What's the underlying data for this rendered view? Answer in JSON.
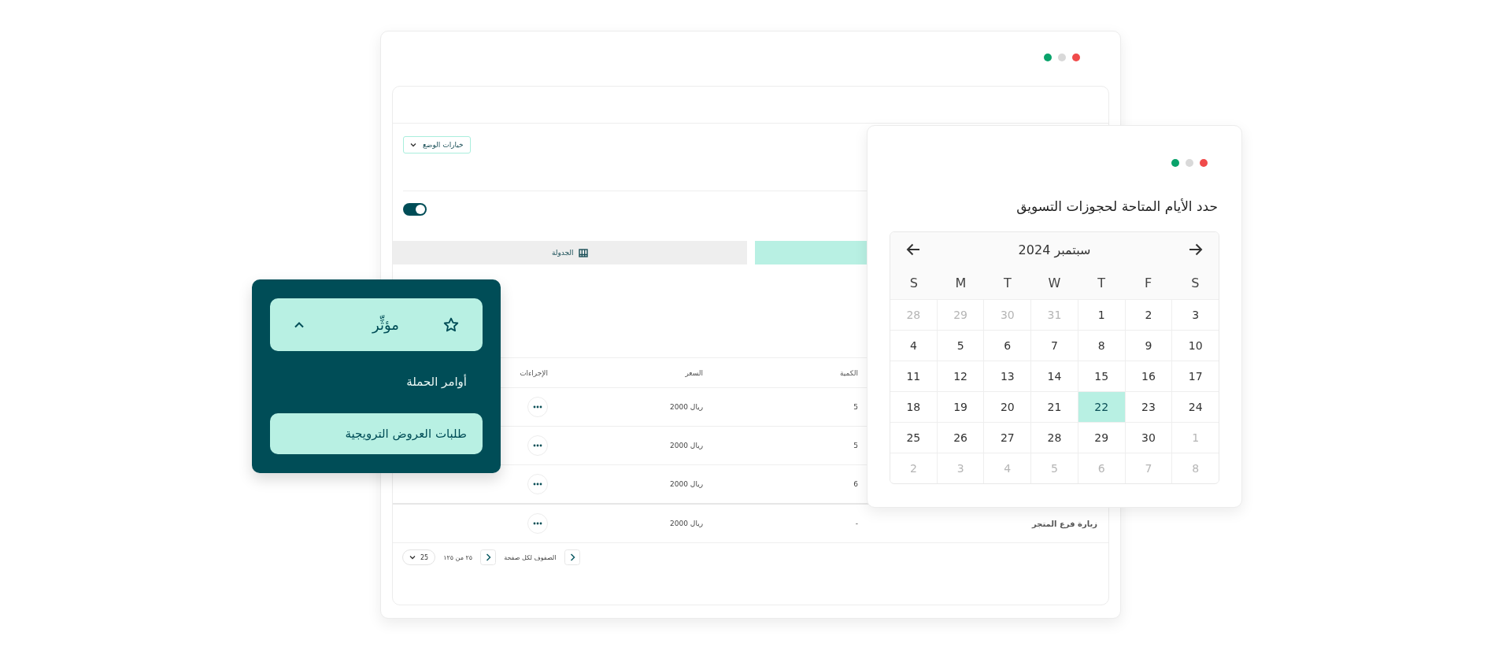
{
  "main_window": {
    "controls": [
      {
        "color": "#0aa36b"
      },
      {
        "color": "#d9d9d9"
      },
      {
        "color": "#f04b4b"
      }
    ],
    "mode_dropdown": {
      "label": "خيارات الوضع"
    },
    "toggle": {
      "on": true
    },
    "tabs": [
      {
        "label": "الجدولة",
        "selected": false
      },
      {
        "selected": true
      }
    ],
    "table": {
      "columns": [
        "الكمية",
        "السعر",
        "الإجراءات"
      ],
      "rows": [
        {
          "quantity": "5",
          "price": "ريال 2000"
        },
        {
          "quantity": "5",
          "price": "ريال 2000"
        },
        {
          "quantity": "6",
          "price": "ريال 2000"
        },
        {
          "name": "زيارة فرع المتجر",
          "quantity": "-",
          "price": "ريال 2000"
        }
      ]
    },
    "pagination": {
      "page_size": "25",
      "range": "٢٥ من ١٢٥",
      "rows_per_page": "الصفوف لكل صفحة"
    }
  },
  "calendar_window": {
    "controls": [
      {
        "color": "#0aa36b"
      },
      {
        "color": "#d9d9d9"
      },
      {
        "color": "#f04b4b"
      }
    ],
    "title": "حدد الأيام المتاحة لحجوزات التسويق",
    "calendar": {
      "month": "سبتمبر 2024",
      "weekdays": [
        "S",
        "F",
        "T",
        "W",
        "T",
        "M",
        "S"
      ],
      "days": [
        {
          "label": "3",
          "outside": false,
          "selected": false
        },
        {
          "label": "2",
          "outside": false,
          "selected": false
        },
        {
          "label": "1",
          "outside": false,
          "selected": false
        },
        {
          "label": "31",
          "outside": true,
          "selected": false
        },
        {
          "label": "30",
          "outside": true,
          "selected": false
        },
        {
          "label": "29",
          "outside": true,
          "selected": false
        },
        {
          "label": "28",
          "outside": true,
          "selected": false
        },
        {
          "label": "10",
          "outside": false,
          "selected": false
        },
        {
          "label": "9",
          "outside": false,
          "selected": false
        },
        {
          "label": "8",
          "outside": false,
          "selected": false
        },
        {
          "label": "7",
          "outside": false,
          "selected": false
        },
        {
          "label": "6",
          "outside": false,
          "selected": false
        },
        {
          "label": "5",
          "outside": false,
          "selected": false
        },
        {
          "label": "4",
          "outside": false,
          "selected": false
        },
        {
          "label": "17",
          "outside": false,
          "selected": false
        },
        {
          "label": "16",
          "outside": false,
          "selected": false
        },
        {
          "label": "15",
          "outside": false,
          "selected": false
        },
        {
          "label": "14",
          "outside": false,
          "selected": false
        },
        {
          "label": "13",
          "outside": false,
          "selected": false
        },
        {
          "label": "12",
          "outside": false,
          "selected": false
        },
        {
          "label": "11",
          "outside": false,
          "selected": false
        },
        {
          "label": "24",
          "outside": false,
          "selected": false
        },
        {
          "label": "23",
          "outside": false,
          "selected": false
        },
        {
          "label": "22",
          "outside": false,
          "selected": true
        },
        {
          "label": "21",
          "outside": false,
          "selected": false
        },
        {
          "label": "20",
          "outside": false,
          "selected": false
        },
        {
          "label": "19",
          "outside": false,
          "selected": false
        },
        {
          "label": "18",
          "outside": false,
          "selected": false
        },
        {
          "label": "1",
          "outside": true,
          "selected": false
        },
        {
          "label": "30",
          "outside": false,
          "selected": false
        },
        {
          "label": "29",
          "outside": false,
          "selected": false
        },
        {
          "label": "28",
          "outside": false,
          "selected": false
        },
        {
          "label": "27",
          "outside": false,
          "selected": false
        },
        {
          "label": "26",
          "outside": false,
          "selected": false
        },
        {
          "label": "25",
          "outside": false,
          "selected": false
        },
        {
          "label": "8",
          "outside": true,
          "selected": false
        },
        {
          "label": "7",
          "outside": true,
          "selected": false
        },
        {
          "label": "6",
          "outside": true,
          "selected": false
        },
        {
          "label": "5",
          "outside": true,
          "selected": false
        },
        {
          "label": "4",
          "outside": true,
          "selected": false
        },
        {
          "label": "3",
          "outside": true,
          "selected": false
        },
        {
          "label": "2",
          "outside": true,
          "selected": false
        }
      ]
    }
  },
  "menu": {
    "header": {
      "label": "مؤثِّر",
      "expanded": true
    },
    "items": [
      {
        "label": "أوامر الحملة",
        "selected": false
      },
      {
        "label": "طلبات العروض الترويجية",
        "selected": true
      }
    ]
  }
}
